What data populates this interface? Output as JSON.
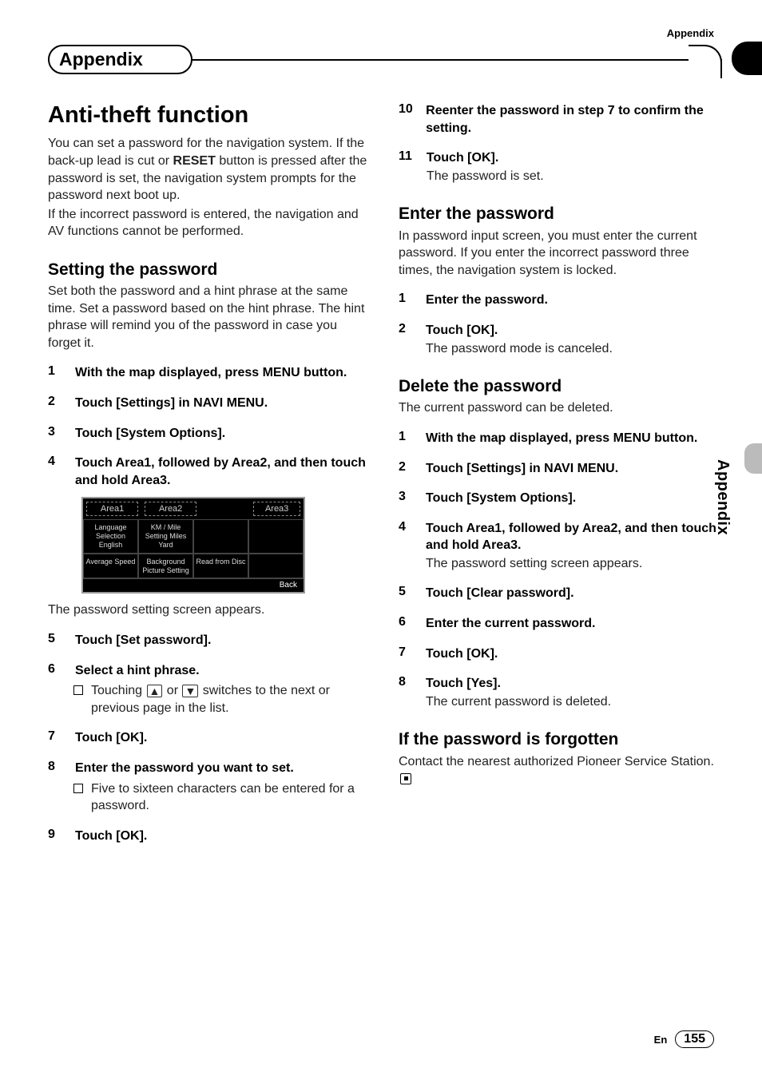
{
  "header": {
    "top_right": "Appendix",
    "section_tab": "Appendix",
    "side_vertical": "Appendix"
  },
  "footer": {
    "lang": "En",
    "page": "155"
  },
  "left": {
    "h1": "Anti-theft function",
    "intro1_a": "You can set a password for the navigation system. If the back-up lead is cut or ",
    "intro1_reset": "RESET",
    "intro1_b": " button is pressed after the password is set, the navigation system prompts for the password next boot up.",
    "intro2": "If the incorrect password is entered, the navigation and AV functions cannot be performed.",
    "h2_1": "Setting the password",
    "intro3": "Set both the password and a hint phrase at the same time. Set a password based on the hint phrase. The hint phrase will remind you of the password in case you forget it.",
    "steps": {
      "s1n": "1",
      "s1t": "With the map displayed, press MENU button.",
      "s2n": "2",
      "s2t": "Touch [Settings] in NAVI MENU.",
      "s3n": "3",
      "s3t": "Touch [System Options].",
      "s4n": "4",
      "s4t": "Touch Area1, followed by Area2, and then touch and hold Area3."
    },
    "screenshot": {
      "area1": "Area1",
      "area2": "Area2",
      "area3": "Area3",
      "cells": [
        "Language Selection English",
        "KM / Mile Setting Miles Yard",
        "",
        "",
        "Average Speed",
        "Background Picture Setting",
        "Read from Disc",
        ""
      ],
      "back": "Back"
    },
    "after_ss": "The password setting screen appears.",
    "s5n": "5",
    "s5t": "Touch [Set password].",
    "s6n": "6",
    "s6t": "Select a hint phrase.",
    "s6_bullet_a": "Touching ",
    "s6_bullet_b": " or ",
    "s6_bullet_c": " switches to the next or previous page in the list.",
    "s7n": "7",
    "s7t": "Touch [OK].",
    "s8n": "8",
    "s8t": "Enter the password you want to set.",
    "s8_bullet": "Five to sixteen characters can be entered for a password.",
    "s9n": "9",
    "s9t": "Touch [OK]."
  },
  "right": {
    "s10n": "10",
    "s10t": "Reenter the password in step 7 to confirm the setting.",
    "s11n": "11",
    "s11t": "Touch [OK].",
    "s11_after": "The password is set.",
    "h2_1": "Enter the password",
    "intro1": "In password input screen, you must enter the current password. If you enter the incorrect password three times, the navigation system is locked.",
    "e1n": "1",
    "e1t": "Enter the password.",
    "e2n": "2",
    "e2t": "Touch [OK].",
    "e2_after": "The password mode is canceled.",
    "h2_2": "Delete the password",
    "intro2": "The current password can be deleted.",
    "d1n": "1",
    "d1t": "With the map displayed, press MENU button.",
    "d2n": "2",
    "d2t": "Touch [Settings] in NAVI MENU.",
    "d3n": "3",
    "d3t": "Touch [System Options].",
    "d4n": "4",
    "d4t": "Touch Area1, followed by Area2, and then touch and hold Area3.",
    "d4_after": "The password setting screen appears.",
    "d5n": "5",
    "d5t": "Touch [Clear password].",
    "d6n": "6",
    "d6t": "Enter the current password.",
    "d7n": "7",
    "d7t": "Touch [OK].",
    "d8n": "8",
    "d8t": "Touch [Yes].",
    "d8_after": "The current password is deleted.",
    "h2_3": "If the password is forgotten",
    "intro3": "Contact the nearest authorized Pioneer Service Station."
  }
}
